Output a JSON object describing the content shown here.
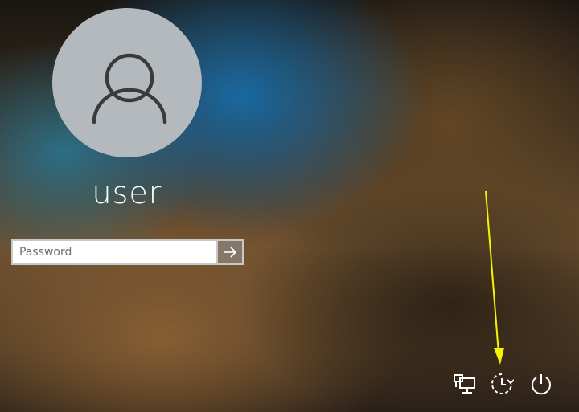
{
  "user": {
    "name": "user",
    "avatar_icon": "person-icon"
  },
  "password": {
    "placeholder": "Password",
    "value": "",
    "submit_icon": "arrow-right-icon"
  },
  "tray": {
    "network_icon": "network-icon",
    "ease_of_access_icon": "ease-of-access-icon",
    "power_icon": "power-icon"
  },
  "annotation": {
    "color": "#f5f500",
    "icon": "arrow-annotation-icon"
  }
}
